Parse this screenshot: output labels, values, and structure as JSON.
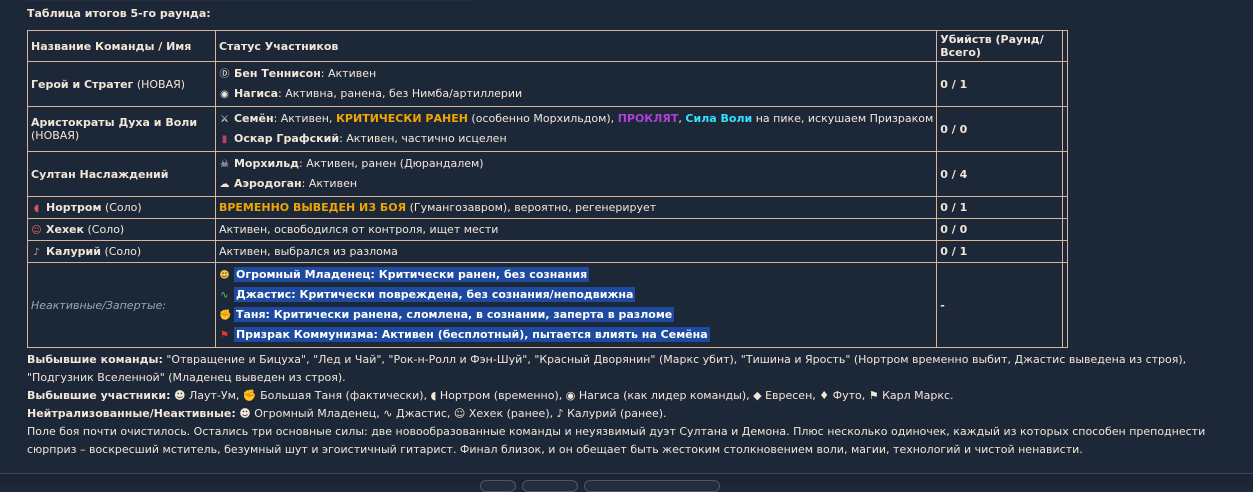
{
  "heading": "Таблица итогов 5-го раунда:",
  "table": {
    "headers": [
      "Название Команды / Имя",
      "Статус Участников",
      "Убийств (Раунд/Всего)"
    ],
    "rows": [
      {
        "team": "Герой и Стратег",
        "note": "(НОВАЯ)",
        "members": [
          {
            "icon": "Ⓓ",
            "name": "Бен Теннисон",
            "status": "Активен"
          },
          {
            "icon": "◉",
            "name": "Нагиса",
            "status": "Активна, ранена, без Нимба/артиллерии"
          }
        ],
        "kills": "0 / 1"
      },
      {
        "team": "Аристократы Духа и Воли",
        "note": "(НОВАЯ)",
        "members": [
          {
            "icon": "⚔",
            "name": "Семён",
            "pre": "Активен, ",
            "critical": "КРИТИЧЕСКИ РАНЕН",
            "mid": " (особенно Морхильдом), ",
            "cursed": "ПРОКЛЯТ",
            "sep": ", ",
            "will": "Сила Воли",
            "post": " на пике, искушаем Призраком"
          },
          {
            "icon": "▮",
            "name": "Оскар Графский",
            "status": "Активен, частично исцелен"
          }
        ],
        "kills": "0 / 0"
      },
      {
        "team": "Султан Наслаждений",
        "note": "",
        "members": [
          {
            "icon": "☠",
            "name": "Морхильд",
            "status": "Активен, ранен (Дюрандалем)"
          },
          {
            "icon": "☁",
            "name": "Аэродоган",
            "status": "Активен"
          }
        ],
        "kills": "0 / 4"
      },
      {
        "team_icon": "◖",
        "team": "Нортром",
        "note": "(Соло)",
        "critical": "ВРЕМЕННО ВЫВЕДЕН ИЗ БОЯ",
        "status": " (Гумангозавром), вероятно, регенерирует",
        "kills": "0 / 1"
      },
      {
        "team_icon": "☺",
        "team": "Хехек",
        "note": "(Соло)",
        "status": "Активен, освободился от контроля, ищет мести",
        "kills": "0 / 0"
      },
      {
        "team_icon": "♪",
        "team": "Калурий",
        "note": "(Соло)",
        "status": "Активен, выбрался из разлома",
        "kills": "0 / 1"
      }
    ],
    "inactive": {
      "label": "Неактивные/Запертые:",
      "members": [
        {
          "icon": "☻",
          "text": "Огромный Младенец: Критически ранен, без сознания"
        },
        {
          "icon": "∿",
          "text": "Джастис: Критически повреждена, без сознания/неподвижна"
        },
        {
          "icon": "✊",
          "text": "Таня: Критически ранена, сломлена, в сознании, заперта в разломе"
        },
        {
          "icon": "⚑",
          "text": "Призрак Коммунизма: Активен (бесплотный), пытается влиять на Семёна"
        }
      ],
      "kills": "-"
    }
  },
  "summary": {
    "eliminated_teams_label": "Выбывшие команды:",
    "eliminated_teams": "\"Отвращение и Бицуха\", \"Лед и Чай\", \"Рок-н-Ролл и Фэн-Шуй\", \"Красный Дворянин\" (Маркс убит), \"Тишина и Ярость\" (Нортром временно выбит, Джастис выведена из строя), \"Подгузник Вселенной\" (Младенец выведен из строя).",
    "eliminated_members_label": "Выбывшие участники:",
    "eliminated_members": "☻ Лаут-Ум, ✊ Большая Таня (фактически), ◖ Нортром (временно), ◉ Нагиса (как лидер команды), ◆ Евресен, ♦ Футо, ⚑ Карл Маркс.",
    "neutralized_label": "Нейтрализованные/Неактивные:",
    "neutralized": "☻ Огромный Младенец, ∿ Джастис, ☺ Хехек (ранее), ♪ Калурий (ранее).",
    "closing": "Поле боя почти очистилось. Остались три основные силы: две новообразованные команды и неуязвимый дуэт Султана и Демона. Плюс несколько одиночек, каждый из которых способен преподнести сюрприз – воскресший мститель, безумный шут и эгоистичный гитарист. Финал близок, и он обещает быть жестоким столкновением воли, магии, технологий и чистой ненависти."
  }
}
